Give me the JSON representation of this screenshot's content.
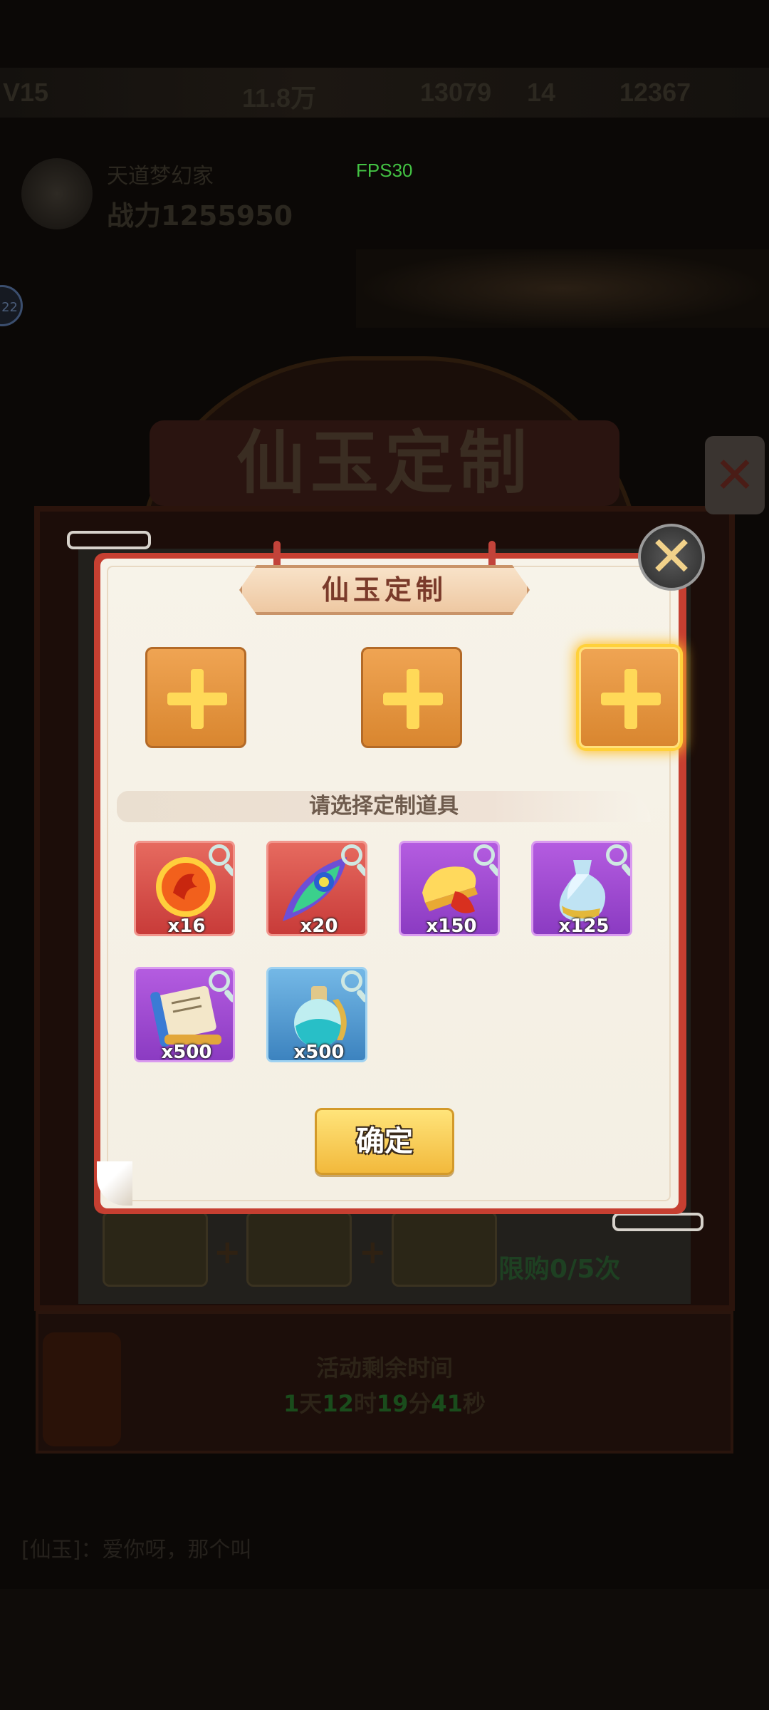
{
  "hud": {
    "level": "V15",
    "res1": "11.8万",
    "res2": "13079",
    "res3": "14",
    "res4": "12367",
    "player_name": "天道梦幻家",
    "power": "战力1255950",
    "fps": "FPS30",
    "badge": "22"
  },
  "background": {
    "title": "仙玉定制",
    "close": "✕",
    "plus": "+",
    "limit": "限购0/5次",
    "timer_title": "活动剩余时间",
    "timer": {
      "d": "1",
      "d_unit": "天",
      "h": "12",
      "h_unit": "时",
      "m": "19",
      "m_unit": "分",
      "s": "41",
      "s_unit": "秒"
    },
    "bottom_text": "[仙玉]：爱你呀，那个叫"
  },
  "modal": {
    "title": "仙玉定制",
    "close_glyph": "✕",
    "section_label": "请选择定制道具",
    "confirm_label": "确定",
    "slots": [
      {
        "selected": false
      },
      {
        "selected": false
      },
      {
        "selected": true
      }
    ],
    "items": [
      {
        "icon": "phoenix-orb-icon",
        "count": "x16",
        "rarity": "red"
      },
      {
        "icon": "peacock-feather-icon",
        "count": "x20",
        "rarity": "red"
      },
      {
        "icon": "golden-comb-icon",
        "count": "x150",
        "rarity": "purple"
      },
      {
        "icon": "jade-vase-icon",
        "count": "x125",
        "rarity": "purple"
      },
      {
        "icon": "scroll-icon",
        "count": "x500",
        "rarity": "purple"
      },
      {
        "icon": "potion-bottle-icon",
        "count": "x500",
        "rarity": "blue"
      }
    ]
  },
  "colors": {
    "modal_border": "#c63f31",
    "paper": "#f7f3e9",
    "slot_orange": "#e29440",
    "selected_glow": "#ffd13a",
    "confirm_yellow": "#ffd35a",
    "fps_green": "#43c243"
  }
}
